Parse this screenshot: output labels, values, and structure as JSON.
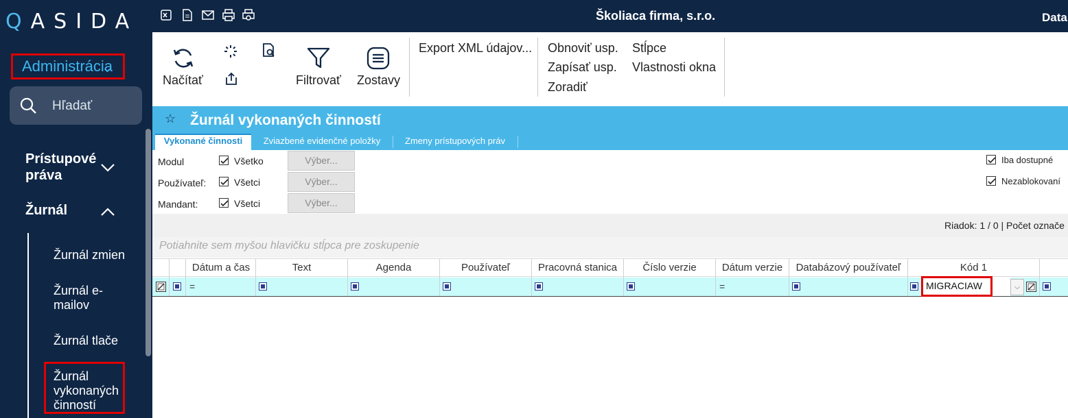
{
  "app": {
    "logo_text": "ASIDA",
    "company": "Školiaca firma, s.r.o.",
    "top_right": "Data"
  },
  "sidebar": {
    "module": "Administrácia",
    "search_placeholder": "Hľadať",
    "groups": [
      {
        "label": "Prístupové práva",
        "expanded": false
      },
      {
        "label": "Žurnál",
        "expanded": true
      }
    ],
    "items": [
      "Žurnál zmien",
      "Žurnál e-mailov",
      "Žurnál tlače",
      "Žurnál vykonaných činností"
    ],
    "active_item": "Žurnál vykonaných činností"
  },
  "toolbar_icons": [
    "excel-export-icon",
    "document-icon",
    "email-icon",
    "print-icon",
    "print-preview-icon"
  ],
  "ribbon": {
    "load": "Načítať",
    "filter": "Filtrovať",
    "reports": "Zostavy",
    "export_xml": "Export XML údajov...",
    "refresh_settings": "Obnoviť usp.",
    "save_settings": "Zapísať usp.",
    "sort": "Zoradiť",
    "columns": "Stĺpce",
    "window_props": "Vlastnosti okna"
  },
  "page": {
    "title": "Žurnál vykonaných činností",
    "tabs": [
      "Vykonané činnosti",
      "Zviazbené evidenčné položky",
      "Zmeny prístupových práv"
    ],
    "active_tab": 0
  },
  "filters": [
    {
      "label": "Modul",
      "checkbox": "Všetko",
      "checked": true,
      "button": "Výber..."
    },
    {
      "label": "Používateľ:",
      "checkbox": "Všetci",
      "checked": true,
      "button": "Výber..."
    },
    {
      "label": "Mandant:",
      "checkbox": "Všetci",
      "checked": true,
      "button": "Výber..."
    }
  ],
  "options": [
    {
      "label": "Iba dostupné",
      "checked": true
    },
    {
      "label": "Nezablokovaní",
      "checked": true
    }
  ],
  "status": "Riadok: 1 / 0 | Počet označe",
  "group_hint": "Potiahnite sem myšou hlavičku stĺpca pre zoskupenie",
  "grid": {
    "columns": [
      "Dátum a čas",
      "Text",
      "Agenda",
      "Používateľ",
      "Pracovná stanica",
      "Číslo verzie",
      "Dátum verzie",
      "Databázový používateľ",
      "Kód 1"
    ],
    "filter_row": {
      "kod1": "MIGRACIAW",
      "equals": "="
    }
  },
  "colors": {
    "sidebar": "#0f2645",
    "accent": "#48b7e8",
    "highlight": "#e00000",
    "filter_row": "#c9fbfb"
  }
}
